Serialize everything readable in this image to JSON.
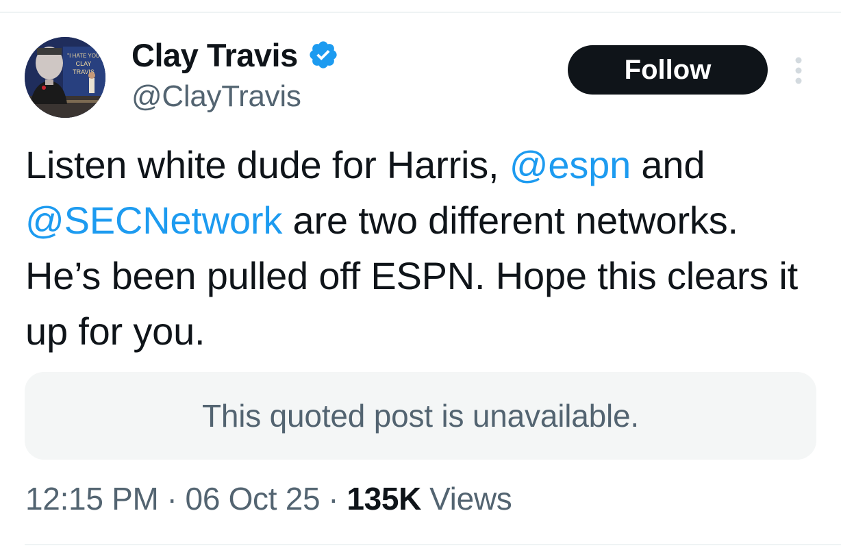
{
  "author": {
    "display_name": "Clay Travis",
    "handle": "@ClayTravis",
    "verified_icon": "verified-badge-icon",
    "avatar_sign_text": "\"I HATE YOU CLAY TRAVIS\""
  },
  "actions": {
    "follow_label": "Follow",
    "more_icon": "more-vertical-icon"
  },
  "tweet": {
    "segments": [
      {
        "type": "text",
        "text": "Listen white dude for Harris, "
      },
      {
        "type": "mention",
        "text": "@espn"
      },
      {
        "type": "text",
        "text": " and "
      },
      {
        "type": "mention",
        "text": "@SECNetwork"
      },
      {
        "type": "text",
        "text": " are two different networks. He’s been pulled off ESPN. Hope this clears it up for you."
      }
    ]
  },
  "quote": {
    "text": "This quoted post is unavailable."
  },
  "meta": {
    "time": "12:15 PM",
    "separator": "·",
    "date": "06 Oct 25",
    "view_count": "135K",
    "views_label": "Views"
  },
  "colors": {
    "accent": "#1d9bf0",
    "text_primary": "#0f1419",
    "text_secondary": "#536471",
    "button_bg": "#0f1419",
    "quote_bg": "#f4f6f6"
  }
}
